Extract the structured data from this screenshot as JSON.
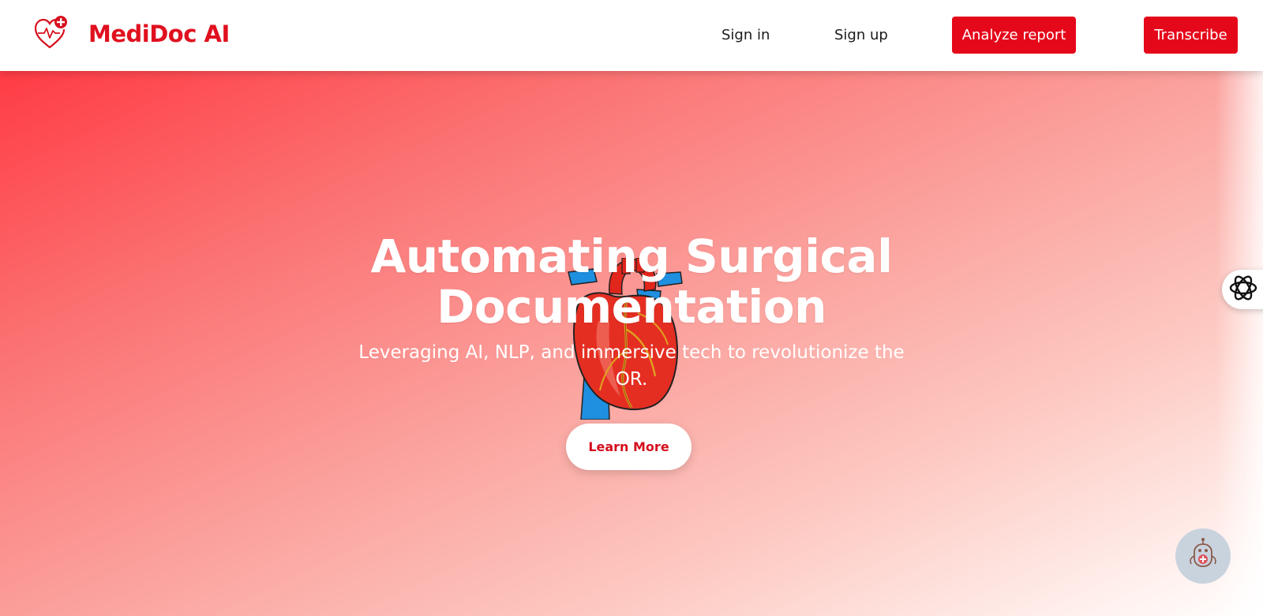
{
  "header": {
    "brand": "MediDoc AI",
    "logo_icon": "heart-pulse-plus-icon",
    "nav": {
      "signin": "Sign in",
      "signup": "Sign up",
      "analyze": "Analyze report",
      "transcribe": "Transcribe"
    }
  },
  "hero": {
    "title": "Automating Surgical Documentation",
    "subtitle": "Leveraging AI, NLP, and immersive tech to revolutionize the OR.",
    "cta": "Learn More",
    "image": "anatomical-heart-illustration"
  },
  "widgets": {
    "side_icon": "openai-knot-icon",
    "chat_icon": "medical-robot-icon"
  },
  "colors": {
    "brand_red": "#e0101f",
    "button_red": "#e5081a",
    "hero_gradient_start": "#ff3b45",
    "hero_gradient_end": "#ffffff",
    "chat_bg": "#c9d3de"
  }
}
